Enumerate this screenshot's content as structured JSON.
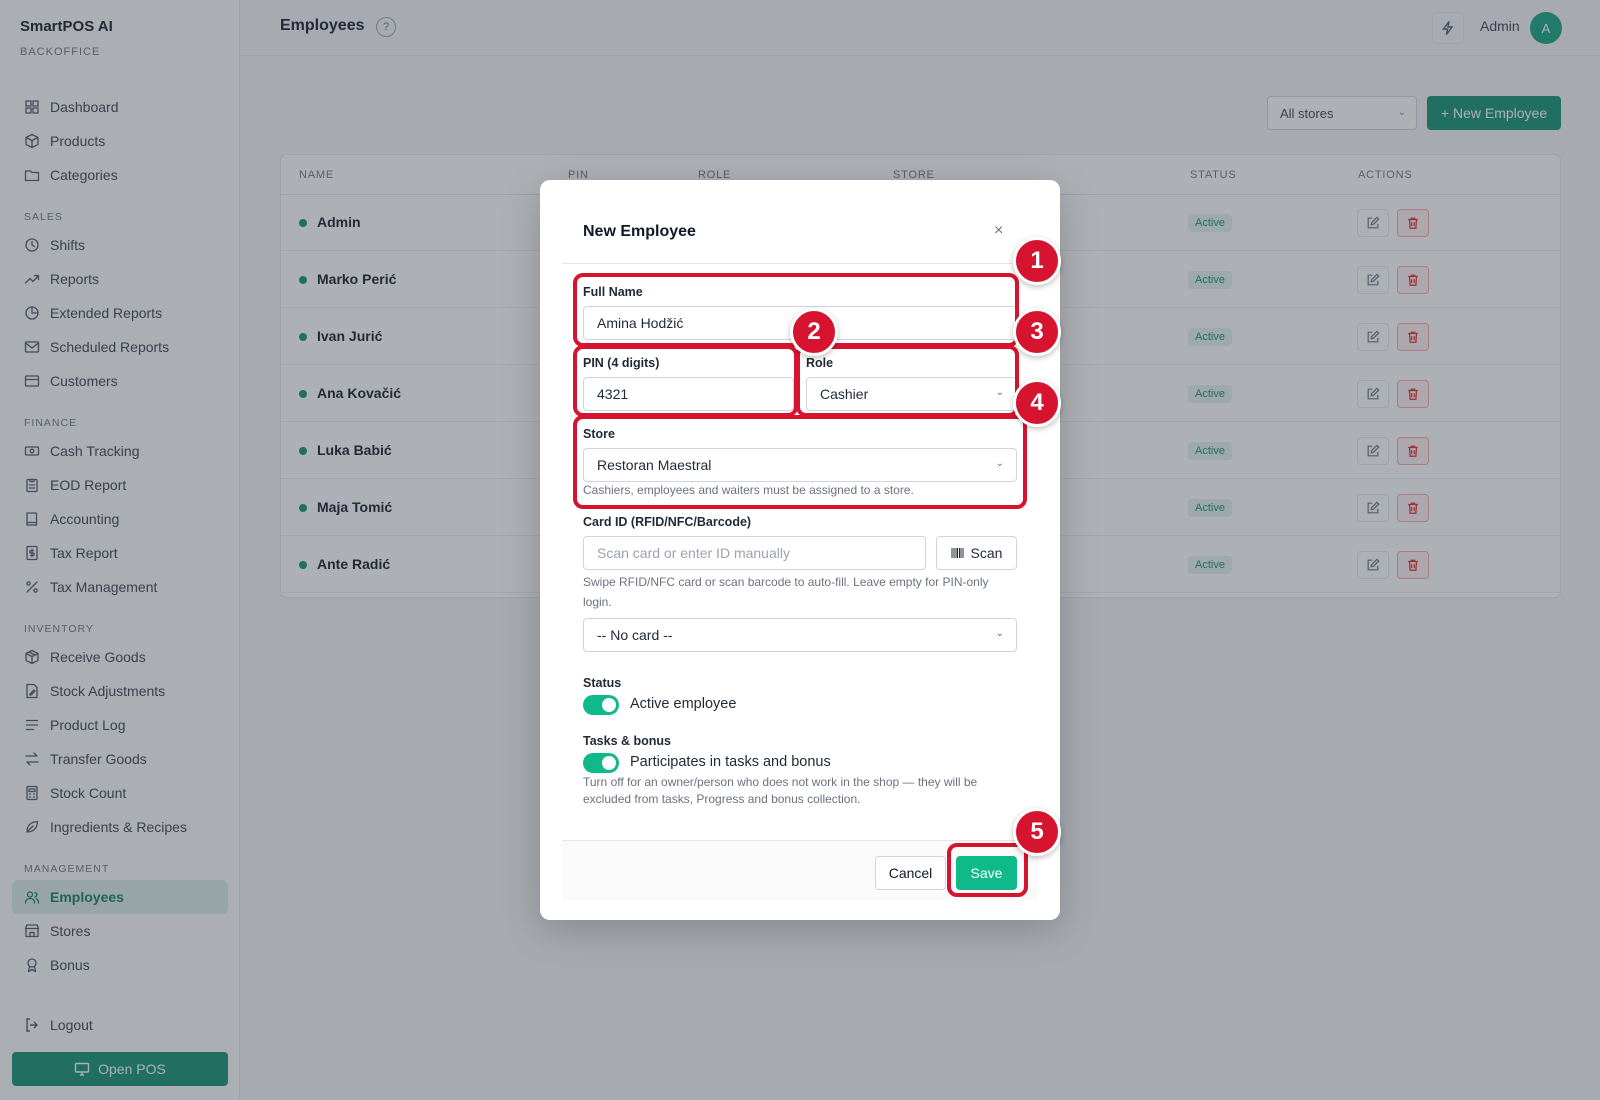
{
  "app": {
    "brand": "SmartPOS AI",
    "subtitle": "BACKOFFICE"
  },
  "sidebar": {
    "items_top": [
      {
        "label": "Dashboard",
        "icon": "dashboard-icon"
      },
      {
        "label": "Products",
        "icon": "box-icon"
      },
      {
        "label": "Categories",
        "icon": "folder-icon"
      }
    ],
    "sections": [
      {
        "title": "SALES",
        "items": [
          {
            "label": "Shifts",
            "icon": "clock-icon"
          },
          {
            "label": "Reports",
            "icon": "trend-icon"
          },
          {
            "label": "Extended Reports",
            "icon": "pie-icon"
          },
          {
            "label": "Scheduled Reports",
            "icon": "mail-icon"
          },
          {
            "label": "Customers",
            "icon": "card-icon"
          }
        ]
      },
      {
        "title": "FINANCE",
        "items": [
          {
            "label": "Cash Tracking",
            "icon": "cash-icon"
          },
          {
            "label": "EOD Report",
            "icon": "clipboard-icon"
          },
          {
            "label": "Accounting",
            "icon": "book-icon"
          },
          {
            "label": "Tax Report",
            "icon": "dollar-file-icon"
          },
          {
            "label": "Tax Management",
            "icon": "percent-icon"
          }
        ]
      },
      {
        "title": "INVENTORY",
        "items": [
          {
            "label": "Receive Goods",
            "icon": "package-in-icon"
          },
          {
            "label": "Stock Adjustments",
            "icon": "file-edit-icon"
          },
          {
            "label": "Product Log",
            "icon": "list-icon"
          },
          {
            "label": "Transfer Goods",
            "icon": "transfer-icon"
          },
          {
            "label": "Stock Count",
            "icon": "calculator-icon"
          },
          {
            "label": "Ingredients & Recipes",
            "icon": "leaf-icon"
          }
        ]
      },
      {
        "title": "MANAGEMENT",
        "items": [
          {
            "label": "Employees",
            "icon": "users-icon",
            "active": true
          },
          {
            "label": "Stores",
            "icon": "store-icon"
          },
          {
            "label": "Bonus",
            "icon": "award-icon"
          }
        ]
      }
    ],
    "logout": "Logout",
    "open_pos": "Open POS"
  },
  "header": {
    "title": "Employees",
    "help": "?",
    "user": "Admin",
    "avatar_initial": "A"
  },
  "toolbar": {
    "store_filter": "All stores",
    "new_employee": "+ New Employee"
  },
  "table": {
    "columns": [
      "NAME",
      "PIN",
      "ROLE",
      "STORE",
      "STATUS",
      "ACTIONS"
    ],
    "rows": [
      {
        "name": "Admin",
        "status": "Active"
      },
      {
        "name": "Marko Perić",
        "status": "Active"
      },
      {
        "name": "Ivan Jurić",
        "status": "Active"
      },
      {
        "name": "Ana Kovačić",
        "status": "Active"
      },
      {
        "name": "Luka Babić",
        "status": "Active"
      },
      {
        "name": "Maja Tomić",
        "status": "Active"
      },
      {
        "name": "Ante Radić",
        "status": "Active"
      }
    ]
  },
  "modal": {
    "title": "New Employee",
    "close": "×",
    "full_name": {
      "label": "Full Name",
      "value": "Amina Hodžić"
    },
    "pin": {
      "label": "PIN (4 digits)",
      "value": "4321"
    },
    "role": {
      "label": "Role",
      "value": "Cashier"
    },
    "store": {
      "label": "Store",
      "value": "Restoran Maestral",
      "hint": "Cashiers, employees and waiters must be assigned to a store."
    },
    "card": {
      "label": "Card ID (RFID/NFC/Barcode)",
      "placeholder": "Scan card or enter ID manually",
      "scan": "Scan",
      "hint": "Swipe RFID/NFC card or scan barcode to auto-fill. Leave empty for PIN-only login.",
      "select": "-- No card --"
    },
    "status": {
      "label": "Status",
      "toggle": "Active employee",
      "on": true
    },
    "tasks": {
      "label": "Tasks & bonus",
      "toggle": "Participates in tasks and bonus",
      "on": true,
      "hint": "Turn off for an owner/person who does not work in the shop — they will be excluded from tasks, Progress and bonus collection."
    },
    "cancel": "Cancel",
    "save": "Save"
  },
  "annotations": [
    "1",
    "2",
    "3",
    "4",
    "5"
  ],
  "colors": {
    "accent": "#0f8f6d",
    "toggle": "#10b98a",
    "annotation": "#d6142f"
  }
}
